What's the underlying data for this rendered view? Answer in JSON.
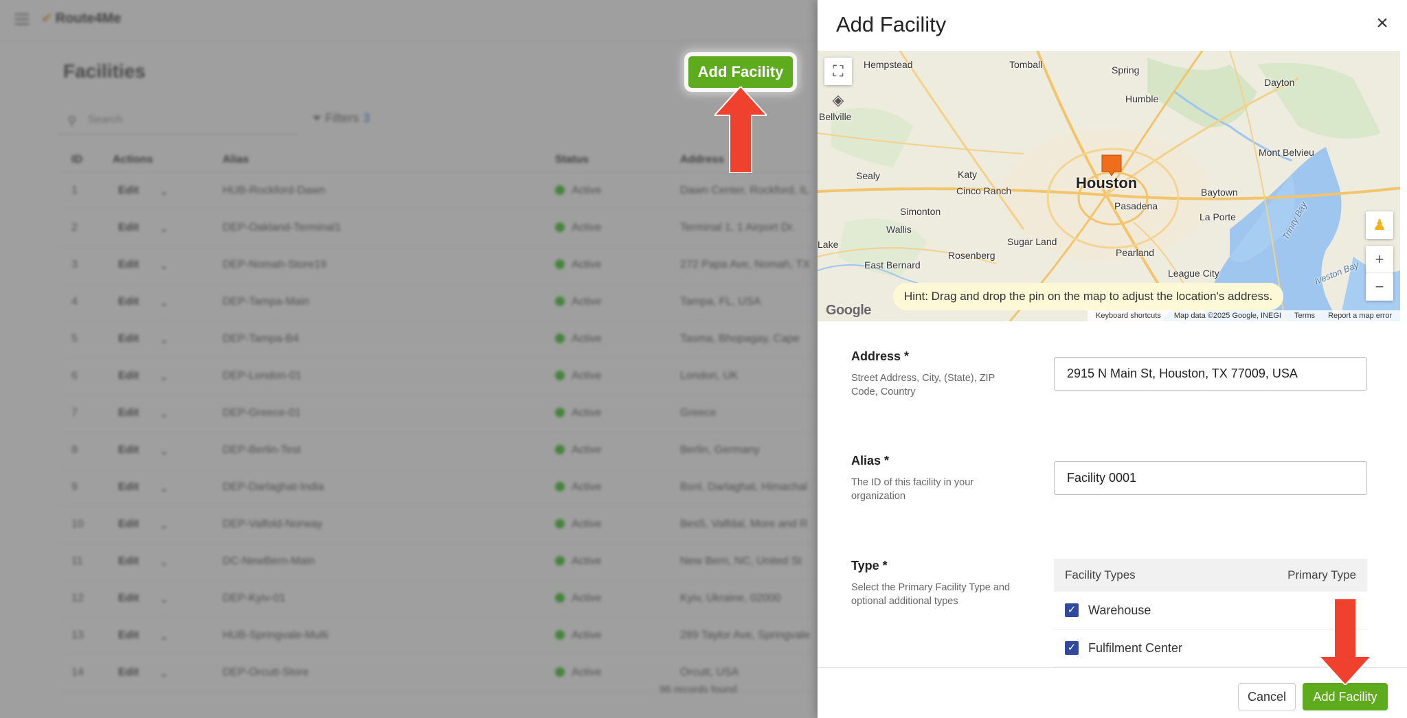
{
  "background": {
    "logo_text": "Route4Me",
    "page_title": "Facilities",
    "add_button_label": "Add Facility",
    "search_placeholder": "Search",
    "filters_label": "Filters",
    "filters_count": "3",
    "columns": [
      "ID",
      "Actions",
      "Alias",
      "Status",
      "Address"
    ],
    "rows": [
      {
        "id": "1",
        "action": "Edit",
        "alias": "HUB-Rockford-Dawn",
        "status": "Active",
        "address": "Dawn Center, Rockford, IL"
      },
      {
        "id": "2",
        "action": "Edit",
        "alias": "DEP-Oakland-Terminal1",
        "status": "Active",
        "address": "Terminal 1, 1 Airport Dr."
      },
      {
        "id": "3",
        "action": "Edit",
        "alias": "DEP-Nomah-Store19",
        "status": "Active",
        "address": "272 Papa Ave, Nomah, TX"
      },
      {
        "id": "4",
        "action": "Edit",
        "alias": "DEP-Tampa-Main",
        "status": "Active",
        "address": "Tampa, FL, USA"
      },
      {
        "id": "5",
        "action": "Edit",
        "alias": "DEP-Tampa-B4",
        "status": "Active",
        "address": "Tasma, Bhopagay, Cape"
      },
      {
        "id": "6",
        "action": "Edit",
        "alias": "DEP-London-01",
        "status": "Active",
        "address": "London, UK"
      },
      {
        "id": "7",
        "action": "Edit",
        "alias": "DEP-Greece-01",
        "status": "Active",
        "address": "Greece"
      },
      {
        "id": "8",
        "action": "Edit",
        "alias": "DEP-Berlin-Test",
        "status": "Active",
        "address": "Berlin, Germany"
      },
      {
        "id": "9",
        "action": "Edit",
        "alias": "DEP-Darlaghat-India",
        "status": "Active",
        "address": "Bsnl, Darlaghat, Himachal"
      },
      {
        "id": "10",
        "action": "Edit",
        "alias": "DEP-Valfold-Norway",
        "status": "Active",
        "address": "Bes5, Valfdal, More and R"
      },
      {
        "id": "11",
        "action": "Edit",
        "alias": "DC-NewBern-Main",
        "status": "Active",
        "address": "New Bern, NC, United St"
      },
      {
        "id": "12",
        "action": "Edit",
        "alias": "DEP-Kyiv-01",
        "status": "Active",
        "address": "Kyiv, Ukraine, 02000"
      },
      {
        "id": "13",
        "action": "Edit",
        "alias": "HUB-Springvale-Multi",
        "status": "Active",
        "address": "289 Taylor Ave, Springvale"
      },
      {
        "id": "14",
        "action": "Edit",
        "alias": "DEP-Orcutt-Store",
        "status": "Active",
        "address": "Orcutt, USA"
      }
    ],
    "records_found": "96 records found"
  },
  "drawer": {
    "title": "Add Facility",
    "close_icon": "×",
    "map": {
      "hint": "Hint: Drag and drop the pin on the map to adjust the location's address.",
      "city_main": "Houston",
      "labels": {
        "hempstead": "Hempstead",
        "tomball": "Tomball",
        "spring": "Spring",
        "dayton": "Dayton",
        "humble": "Humble",
        "bellville": "Bellville",
        "mont_belvieu": "Mont Belvieu",
        "sealy": "Sealy",
        "katy": "Katy",
        "cinco_ranch": "Cinco Ranch",
        "baytown": "Baytown",
        "pasadena": "Pasadena",
        "la_porte": "La Porte",
        "simonton": "Simonton",
        "wallis": "Wallis",
        "sugar_land": "Sugar Land",
        "lake": "Lake",
        "east_bernard": "East Bernard",
        "rosenberg": "Rosenberg",
        "pearland": "Pearland",
        "league_city": "League City",
        "trinity_bay": "Trinity Bay",
        "galveston_bay": "lveston Bay"
      },
      "attribution": {
        "google": "Google",
        "shortcuts": "Keyboard shortcuts",
        "map_data": "Map data ©2025 Google, INEGI",
        "terms": "Terms",
        "report": "Report a map error"
      }
    },
    "address": {
      "label": "Address *",
      "help": "Street Address, City, (State), ZIP Code, Country",
      "value": "2915 N Main St, Houston, TX 77009, USA"
    },
    "alias": {
      "label": "Alias *",
      "help": "The ID of this facility in your organization",
      "value": "Facility 0001"
    },
    "type": {
      "label": "Type *",
      "help": "Select the Primary Facility Type and optional additional types",
      "col_types": "Facility Types",
      "col_primary": "Primary Type",
      "options": [
        {
          "label": "Warehouse",
          "checked": true
        },
        {
          "label": "Fulfilment Center",
          "checked": true
        }
      ]
    },
    "footer": {
      "cancel_label": "Cancel",
      "submit_label": "Add Facility"
    }
  },
  "colors": {
    "accent_green": "#5eab1e",
    "arrow_red": "#f0412f",
    "checkbox_blue": "#2f4a9d",
    "status_green": "#3ec22b"
  }
}
